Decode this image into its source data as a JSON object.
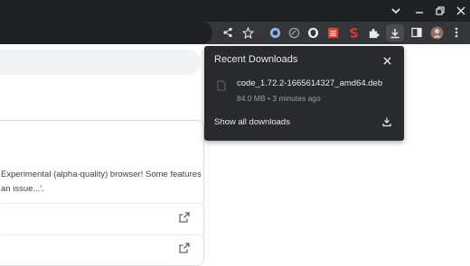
{
  "window": {
    "colors": {
      "titlebar": "#202124",
      "toolbar": "#35363a",
      "popup": "#292a2d"
    }
  },
  "titlebar": {
    "icons": [
      "chevron-down-icon",
      "minimize-icon",
      "restore-icon",
      "close-icon"
    ]
  },
  "toolbar": {
    "icons": [
      "share-icon",
      "bookmark-star-icon",
      "extension-icons",
      "puzzle-icon",
      "download-icon",
      "side-panel-icon",
      "avatar",
      "menu-icon"
    ]
  },
  "downloads_popup": {
    "title": "Recent Downloads",
    "items": [
      {
        "file_name": "code_1.72.2-1665614327_amd64.deb",
        "meta": "84.0 MB • 3 minutes ago"
      }
    ],
    "show_all_label": "Show all downloads"
  },
  "page": {
    "card": {
      "line1": "Experimental (alpha-quality) browser! Some features",
      "line2": "an issue...'."
    }
  }
}
